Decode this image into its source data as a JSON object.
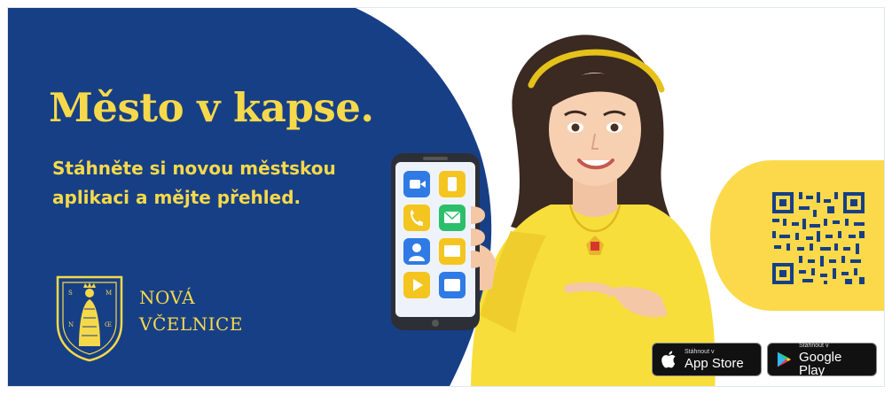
{
  "banner": {
    "headline": "Město v kapse.",
    "subline": "Stáhněte si novou městskou aplikaci a mějte přehled.",
    "town_line1": "NOVÁ",
    "town_line2": "VČELNICE",
    "crest_letters": [
      "S",
      "M",
      "N",
      "Œ"
    ]
  },
  "stores": {
    "apple_small": "Stáhnout v",
    "apple_big": "App Store",
    "google_small": "Stáhnout v",
    "google_big": "Google Play"
  },
  "colors": {
    "navy": "#173f86",
    "yellow": "#f6d94a",
    "sweater": "#f7de3b",
    "qr_bg": "#fbd94a"
  },
  "icons": {
    "app_icons": [
      "video-icon",
      "phone-icon",
      "call-icon",
      "mail-icon",
      "contact-icon",
      "message-icon",
      "play-icon",
      "folder-icon"
    ]
  }
}
